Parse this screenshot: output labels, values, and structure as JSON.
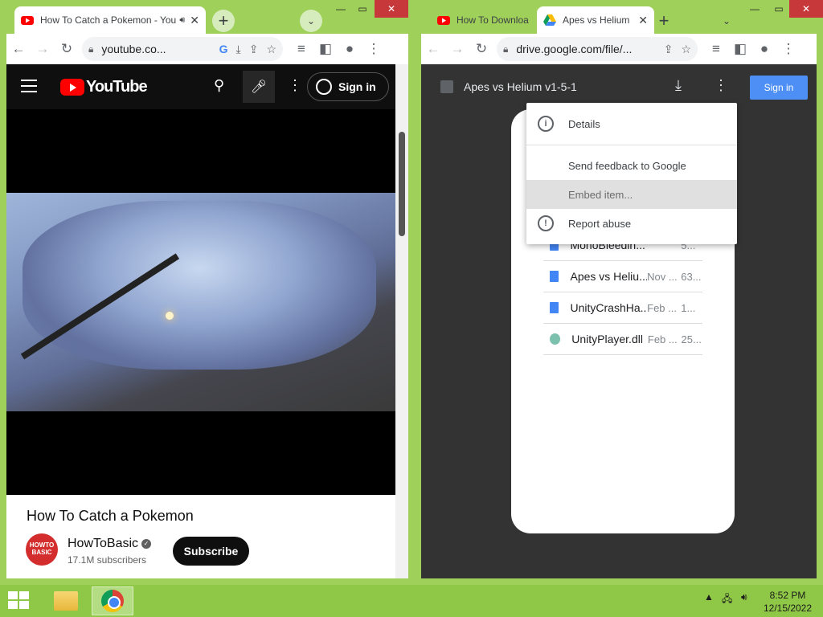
{
  "left_window": {
    "tabs": [
      {
        "title": "How To Catch a Pokemon - YouTube"
      }
    ],
    "url": "youtube.co...",
    "youtube": {
      "logo": "YouTube",
      "sign_in": "Sign in",
      "video_title": "How To Catch a Pokemon",
      "channel_name": "HowToBasic",
      "channel_avatar_text": "HOWTO BASIC",
      "subscribers": "17.1M subscribers",
      "subscribe": "Subscribe"
    }
  },
  "right_window": {
    "tabs": [
      {
        "title": "How To Download"
      },
      {
        "title": "Apes vs Helium"
      }
    ],
    "url": "drive.google.com/file/...",
    "drive": {
      "file_title": "Apes vs Helium v1-5-1",
      "sign_in": "Sign in",
      "files": [
        {
          "name": "MonoBleedin...",
          "date": "",
          "size": "5..."
        },
        {
          "name": "Apes vs Heliu...",
          "date": "Nov ...",
          "size": "63..."
        },
        {
          "name": "UnityCrashHa...",
          "date": "Feb ...",
          "size": "1..."
        },
        {
          "name": "UnityPlayer.dll",
          "date": "Feb ...",
          "size": "25..."
        }
      ],
      "menu": {
        "details": "Details",
        "feedback": "Send feedback to Google",
        "embed": "Embed item...",
        "report": "Report abuse"
      }
    }
  },
  "taskbar": {
    "time": "8:52 PM",
    "date": "12/15/2022"
  },
  "colors": {
    "window_frame": "#9ed05a",
    "close_button": "#c7383b",
    "youtube_red": "#ff0000",
    "drive_signin": "#4d8ff5"
  }
}
